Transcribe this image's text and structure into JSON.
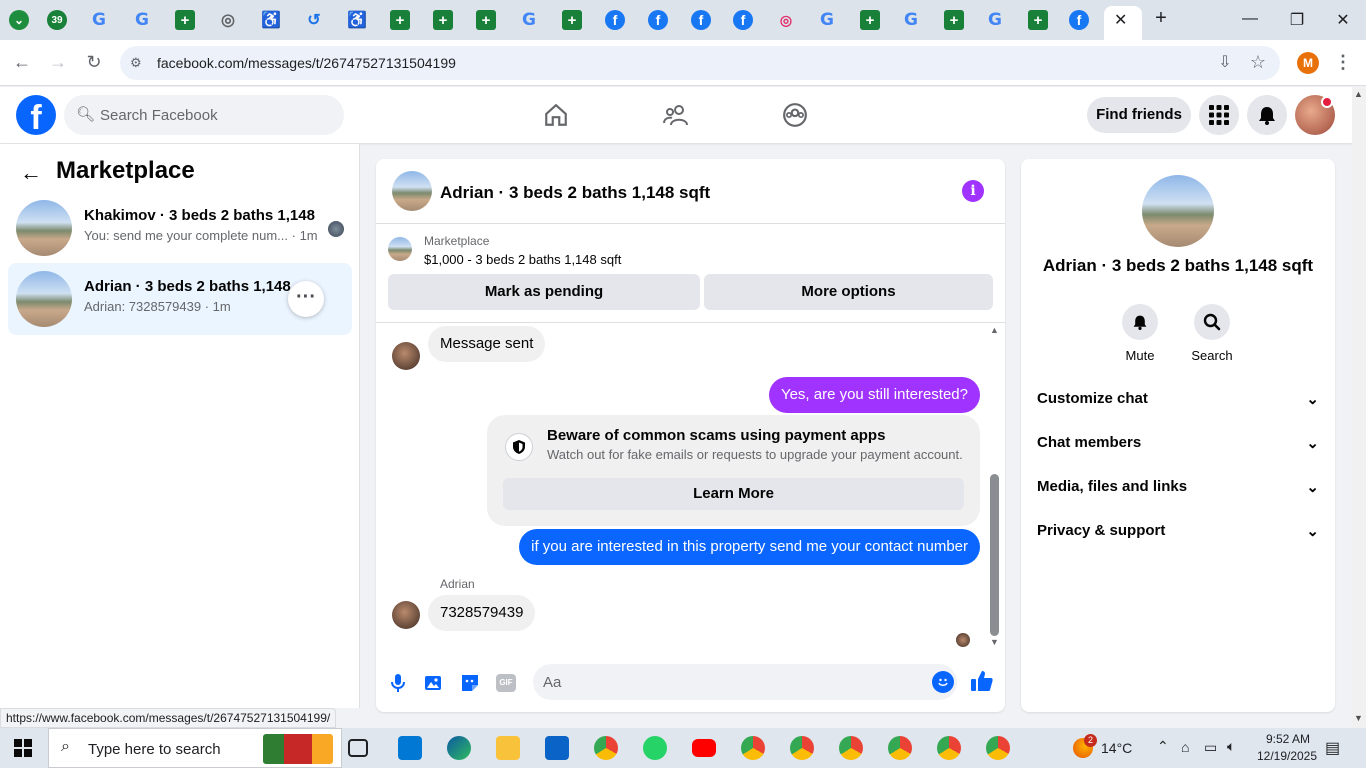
{
  "browser": {
    "url": "facebook.com/messages/t/26747527131504199",
    "profile_initial": "M",
    "tabs_badge": "39",
    "status_url": "https://www.facebook.com/messages/t/26747527131504199/"
  },
  "header": {
    "search_placeholder": "Search Facebook",
    "find_friends_label": "Find friends"
  },
  "sidebar": {
    "title": "Marketplace",
    "conversations": [
      {
        "name": "Khakimov · 3 beds 2 baths 1,148 ...",
        "preview": "You: send me your complete num... · 1m"
      },
      {
        "name": "Adrian · 3 beds 2 baths 1,148 sq",
        "preview": "Adrian: 7328579439 · 1m"
      }
    ]
  },
  "chat": {
    "title": "Adrian · 3 beds 2 baths 1,148 sqft",
    "marketplace_label": "Marketplace",
    "listing": "$1,000 - 3 beds 2 baths 1,148 sqft",
    "mark_pending_label": "Mark as pending",
    "more_options_label": "More options",
    "messages": {
      "message_sent": "Message sent",
      "out_1": "Yes, are you still interested?",
      "scam_title": "Beware of common scams using payment apps",
      "scam_subtitle": "Watch out for fake emails or requests to upgrade your payment account.",
      "learn_more_label": "Learn More",
      "out_2": "if you are interested in this property send me your contact number",
      "sender_name": "Adrian",
      "in_2": "7328579439"
    },
    "composer_placeholder": "Aa",
    "colors": {
      "out_bubble_1": "#a033ff",
      "out_bubble_2": "#0a66ff",
      "accent": "#a033ff"
    }
  },
  "info_panel": {
    "title": "Adrian · 3 beds 2 baths 1,148 sqft",
    "actions": [
      {
        "label": "Mute"
      },
      {
        "label": "Search"
      }
    ],
    "sections": [
      {
        "label": "Customize chat"
      },
      {
        "label": "Chat members"
      },
      {
        "label": "Media, files and links"
      },
      {
        "label": "Privacy & support"
      }
    ]
  },
  "taskbar": {
    "search_placeholder": "Type here to search",
    "weather": "14°C",
    "weather_badge": "2",
    "time": "9:52 AM",
    "date": "12/19/2025"
  }
}
